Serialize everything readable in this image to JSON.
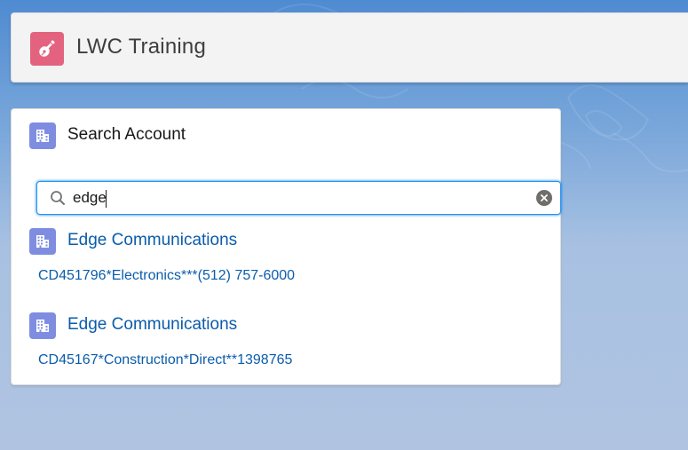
{
  "header": {
    "app_icon": "guitar-icon",
    "title": "LWC Training"
  },
  "search_card": {
    "icon": "account-building-icon",
    "title": "Search Account",
    "search": {
      "value": "edge",
      "placeholder": ""
    },
    "results": [
      {
        "icon": "account-building-icon",
        "name": "Edge Communications",
        "detail": "CD451796*Electronics***(512) 757-6000"
      },
      {
        "icon": "account-building-icon",
        "name": "Edge Communications",
        "detail": "CD45167*Construction*Direct**1398765"
      }
    ]
  },
  "colors": {
    "app_icon_bg": "#e3637f",
    "account_icon_bg": "#7f8de1",
    "link": "#0b5cab",
    "focus_border": "#1b96ff"
  }
}
